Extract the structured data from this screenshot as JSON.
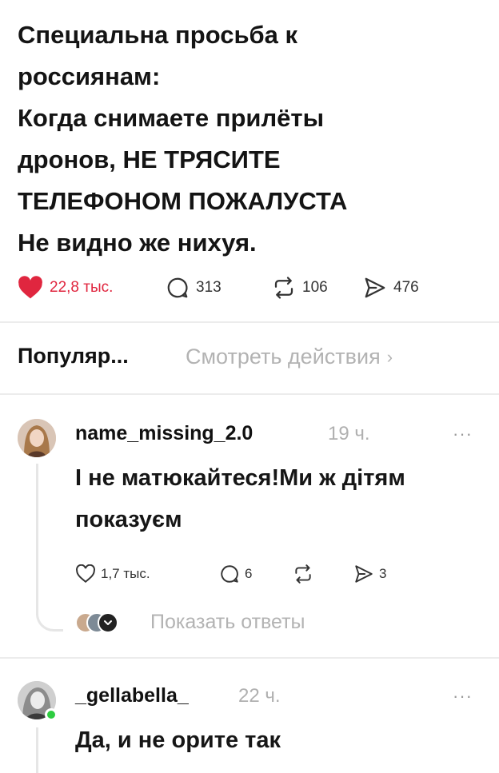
{
  "post": {
    "lines": [
      "Специальна просьба к",
      "россиянам:",
      "Когда снимаете прилёты",
      "дронов, НЕ ТРЯСИТЕ",
      "ТЕЛЕФОНОМ ПОЖАЛУСТА",
      "Не видно же нихуя."
    ],
    "likes": "22,8 тыс.",
    "comments": "313",
    "reposts": "106",
    "shares": "476"
  },
  "sort": {
    "label": "Популяр...",
    "see_actions": "Смотреть действия",
    "chevron": "›"
  },
  "comments": [
    {
      "username": "name_missing_2.0",
      "time": "19 ч.",
      "more": "···",
      "lines": [
        "І не матюкайтеся!Ми ж дітям",
        "показуєм"
      ],
      "likes": "1,7 тыс.",
      "replies": "6",
      "shares": "3",
      "show_replies": "Показать ответы"
    },
    {
      "username": "_gellabella_",
      "time": "22 ч.",
      "more": "···",
      "lines": [
        "Да, и не орите так"
      ]
    }
  ],
  "colors": {
    "heart": "#e0263f",
    "muted": "#b3b3b3",
    "online": "#2ecc40"
  }
}
